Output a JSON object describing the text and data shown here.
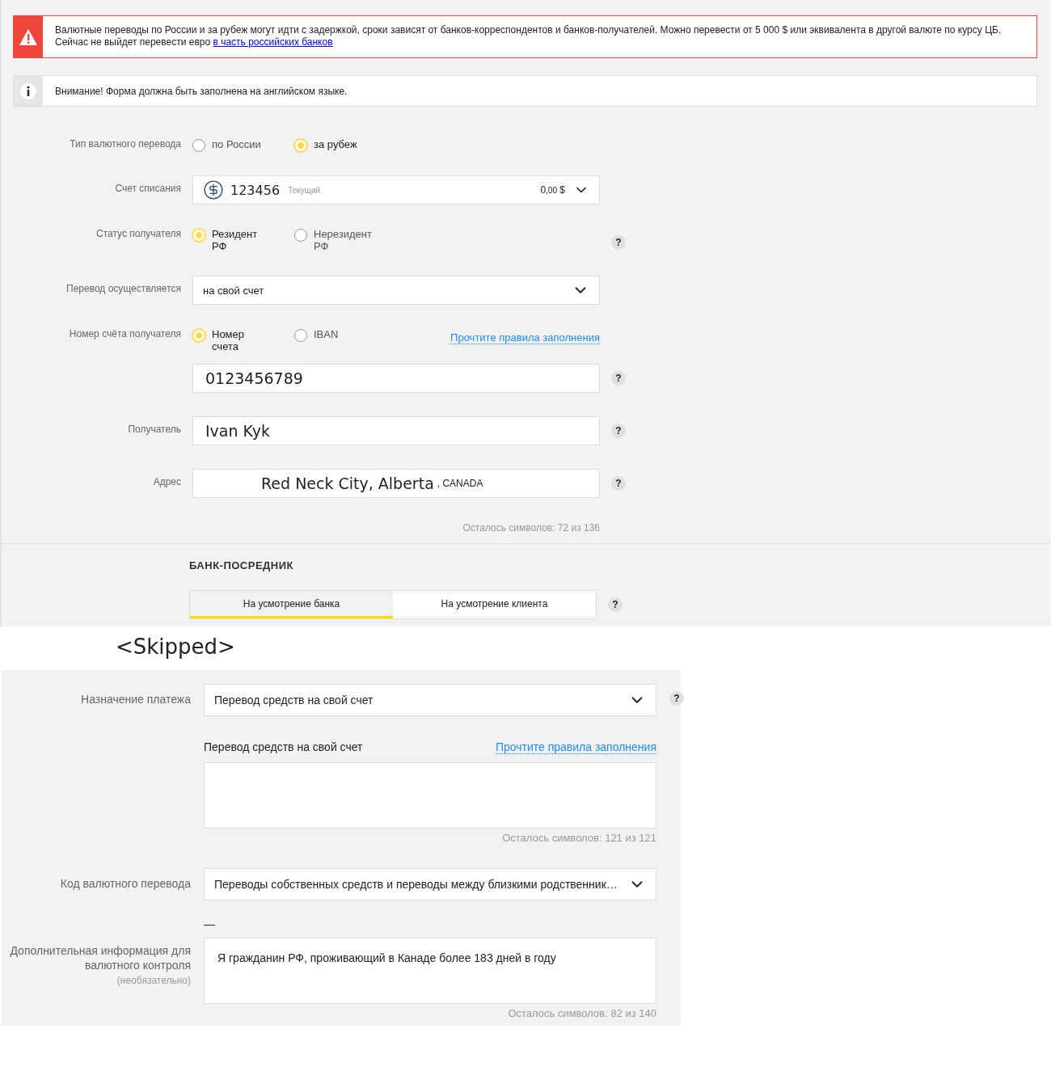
{
  "alert": {
    "text": "Валютные переводы по России и за рубеж могут идти с задержкой, сроки зависят от банков-корреспондентов и банков-получателей. Можно перевести от 5 000 $ или эквивалента в другой валюте по курсу ЦБ. Сейчас не выйдет перевести евро ",
    "link": "в часть российских банков"
  },
  "notice": {
    "text": "Внимание! Форма должна быть заполнена на английском языке."
  },
  "transfer_form": {
    "rows": [
      {
        "kind": "radio",
        "label": "Тип валютного перевода",
        "options": [
          {
            "label": "по России",
            "selected": false
          },
          {
            "label": "за рубеж",
            "selected": true
          }
        ]
      },
      {
        "kind": "account",
        "label": "Счет списания",
        "number": "123456",
        "type": "Текущий",
        "amount": "0",
        "fraction": ",00",
        "currency": "$"
      },
      {
        "kind": "radio",
        "label": "Статус получателя",
        "options": [
          {
            "label": "Резидент РФ",
            "selected": true
          },
          {
            "label": "Нерезидент РФ",
            "selected": false
          }
        ],
        "help": "?"
      },
      {
        "kind": "select",
        "label": "Перевод осуществляется",
        "value": "на свой счет"
      },
      {
        "kind": "radio",
        "label": "Номер счёта получателя",
        "options": [
          {
            "label": "Номер счета",
            "selected": true
          },
          {
            "label": "IBAN",
            "selected": false
          }
        ],
        "link": "Прочтите правила заполнения"
      },
      {
        "kind": "input",
        "value": "0123456789",
        "help": "?"
      },
      {
        "kind": "input",
        "label": "Получатель",
        "value": "Ivan Kyk",
        "help": "?"
      },
      {
        "kind": "input",
        "label": "Адрес",
        "value": "Red Neck City, Alberta",
        "suffix": ", CANADA",
        "help": "?",
        "counter": "Осталось символов: 72 из 136"
      }
    ],
    "section_title": "БАНК-ПОСРЕДНИК",
    "tabs": [
      {
        "label": "На усмотрение банка",
        "selected": true
      },
      {
        "label": "На усмотрение клиента",
        "selected": false
      }
    ],
    "tabs_help": "?"
  },
  "separator_note": "<Skipped>",
  "purpose_form": {
    "rows": [
      {
        "kind": "select",
        "label": "Назначение платежа",
        "value": "Перевод средств на свой счет",
        "help": "?"
      },
      {
        "kind": "textarea",
        "caption": "Перевод средств на свой счет",
        "link": "Прочтите правила заполнения",
        "counter": "Осталось символов: 121 из 121"
      },
      {
        "kind": "select",
        "label": "Код валютного перевода",
        "value": "Переводы собственных средств и переводы между близкими родственник…"
      },
      {
        "kind": "textarea",
        "label": "Дополнительная информация для валютного контроля",
        "label_note": "(необязательно)",
        "marker": "—",
        "value": "Я гражданин РФ, проживающий в Канаде более 183 дней в году",
        "counter": "Осталось символов: 82 из 140"
      }
    ]
  }
}
